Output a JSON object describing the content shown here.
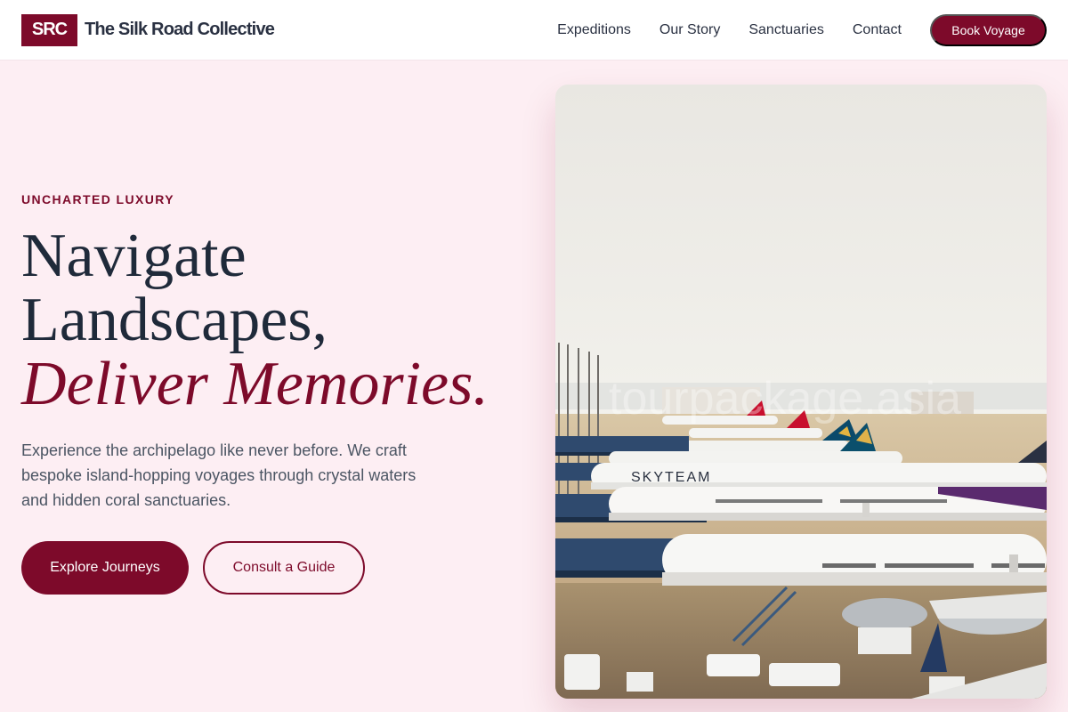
{
  "header": {
    "brand_mark": "SRC",
    "brand_name": "The Silk Road Collective",
    "nav": [
      {
        "label": "Expeditions"
      },
      {
        "label": "Our Story"
      },
      {
        "label": "Sanctuaries"
      },
      {
        "label": "Contact"
      }
    ],
    "cta_label": "Book Voyage"
  },
  "hero": {
    "eyebrow": "UNCHARTED LUXURY",
    "headline_line1": "Navigate",
    "headline_line2": "Landscapes,",
    "headline_accent": "Deliver Memories.",
    "lede": "Experience the archipelago like never before. We craft bespoke island-hopping voyages through crystal waters and hidden coral sanctuaries.",
    "primary_button": "Explore Journeys",
    "secondary_button": "Consult a Guide",
    "image": {
      "subject": "airport apron with parked airliners at gates",
      "watermark": "tourpackage.asia",
      "fuselage_text": "SKYTEAM"
    }
  },
  "colors": {
    "brand": "#7d0a2a",
    "background": "#fdeef3",
    "text_dark": "#1f2a3a",
    "text_muted": "#4b5563"
  }
}
